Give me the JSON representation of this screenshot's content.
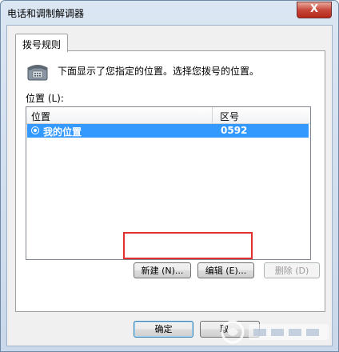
{
  "window": {
    "title": "电话和调制解调器",
    "close_glyph": "X"
  },
  "tabs": [
    {
      "label": "拨号规则",
      "selected": true
    }
  ],
  "dialing_rules": {
    "description": "下面显示了您指定的位置。选择您拨号的位置。",
    "locations_label": "位置 (L):",
    "columns": [
      "位置",
      "区号"
    ],
    "rows": [
      {
        "location": "我的位置",
        "area_code": "0592",
        "selected": true
      }
    ],
    "buttons": {
      "new": "新建 (N)...",
      "edit": "编辑 (E)...",
      "delete": "删除 (D)"
    }
  },
  "footer": {
    "ok": "确定",
    "cancel": "取"
  },
  "colors": {
    "selection": "#3399ff",
    "highlight_box": "#e03030"
  }
}
